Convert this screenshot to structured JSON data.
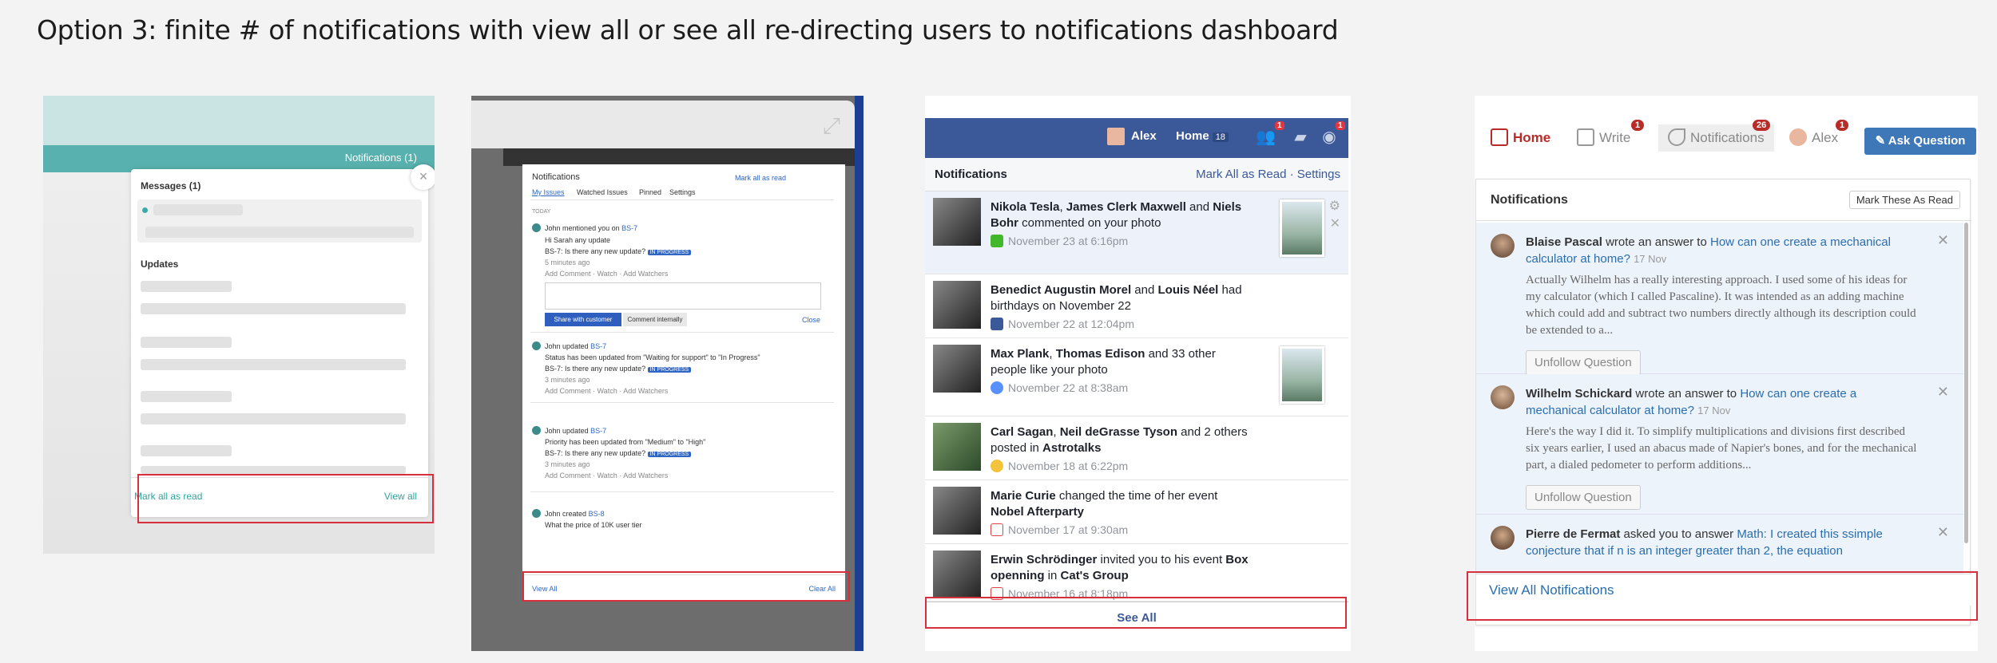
{
  "heading": "Option 3: finite # of notifications with view all or see all re-directing users to notifications dashboard",
  "panel1": {
    "notifications_label": "Notifications (1)",
    "close_glyph": "×",
    "messages_header": "Messages (1)",
    "updates_header": "Updates",
    "mark_all_read": "Mark all as read",
    "view_all": "View all"
  },
  "panel2": {
    "title": "Notifications",
    "mark_all_read": "Mark all as read",
    "tabs": [
      "My Issues",
      "Watched Issues",
      "Pinned",
      "Settings"
    ],
    "section": "TODAY",
    "items": [
      {
        "actor": "John",
        "action": "mentioned you on",
        "key": "BS-7",
        "line": "Hi Sarah any update",
        "issue": "BS-7: Is there any new update?",
        "status": "IN PROGRESS",
        "time": "5 minutes ago",
        "actions": "Add Comment · Watch · Add Watchers"
      },
      {
        "actor": "John",
        "action": "updated",
        "key": "BS-7",
        "line": "Status has been updated from \"Waiting for support\" to \"In Progress\"",
        "issue": "BS-7: Is there any new update?",
        "status": "IN PROGRESS",
        "time": "3 minutes ago",
        "actions": "Add Comment · Watch · Add Watchers"
      },
      {
        "actor": "John",
        "action": "updated",
        "key": "BS-7",
        "line": "Priority has been updated from \"Medium\" to \"High\"",
        "issue": "BS-7: Is there any new update?",
        "status": "IN PROGRESS",
        "time": "3 minutes ago",
        "actions": "Add Comment · Watch · Add Watchers"
      },
      {
        "actor": "John",
        "action": "created",
        "key": "BS-8",
        "line": "What the price of 10K user tier"
      }
    ],
    "share_button": "Share with customer",
    "comment_button": "Comment internally",
    "close": "Close",
    "view_all": "View All",
    "clear_all": "Clear All"
  },
  "panel3": {
    "nav_name": "Alex",
    "nav_home": "Home",
    "nav_home_count": "18",
    "badge_friends": "1",
    "badge_messages": "1",
    "badge_globe": "1",
    "header": "Notifications",
    "header_links": "Mark All as Read · Settings",
    "rows": [
      {
        "bold1": "Nikola Tesla",
        "mid1": ", ",
        "bold2": "James Clerk Maxwell",
        "mid2": " and ",
        "bold3": "Niels Bohr",
        "rest": " commented on your photo",
        "time": "November 23 at 6:16pm"
      },
      {
        "bold1": "Benedict Augustin Morel",
        "mid1": " and ",
        "bold2": "Louis Néel",
        "mid2": "",
        "bold3": "",
        "rest": " had birthdays on November 22",
        "time": "November 22 at 12:04pm"
      },
      {
        "bold1": "Max Plank",
        "mid1": ", ",
        "bold2": "Thomas Edison",
        "mid2": "",
        "bold3": "",
        "rest": " and 33 other people like your photo",
        "time": "November 22 at 8:38am"
      },
      {
        "bold1": "Carl Sagan",
        "mid1": ", ",
        "bold2": "Neil deGrasse Tyson",
        "mid2": " and 2 others posted in ",
        "bold3": "Astrotalks",
        "rest": "",
        "time": "November 18 at 6:22pm"
      },
      {
        "bold1": "Marie Curie",
        "mid1": " changed the time of her event ",
        "bold2": "Nobel Afterparty",
        "mid2": "",
        "bold3": "",
        "rest": "",
        "time": "November 17 at 9:30am"
      },
      {
        "bold1": "Erwin Schrödinger",
        "mid1": " invited you to his event ",
        "bold2": "Box openning",
        "mid2": " in ",
        "bold3": "Cat's Group",
        "rest": "",
        "time": "November 16 at 8:18pm"
      }
    ],
    "see_all": "See All"
  },
  "panel4": {
    "nav_home": "Home",
    "nav_write": "Write",
    "nav_notifications": "Notifications",
    "nav_user": "Alex",
    "badge_write": "1",
    "badge_notifications": "26",
    "badge_user": "1",
    "ask_question": "Ask Question",
    "header": "Notifications",
    "mark_read": "Mark These As Read",
    "items": [
      {
        "name": "Blaise Pascal",
        "action": " wrote an answer to ",
        "link": "How can one create a mechanical calculator at home?",
        "date": "17 Nov",
        "body": "Actually Wilhelm has a really interesting approach. I used some of his ideas for my calculator (which I called Pascaline). It was intended as an adding machine which could add and subtract two numbers directly although its description could be extended to a...",
        "button": "Unfollow Question"
      },
      {
        "name": "Wilhelm Schickard",
        "action": " wrote an answer to ",
        "link": "How can one create a mechanical calculator at home?",
        "date": "17 Nov",
        "body": "Here's the way I did it. To simplify multiplications and divisions first described six years earlier, I used an abacus made of Napier's bones, and for the mechanical part, a dialed pedometer to perform additions...",
        "button": "Unfollow Question"
      },
      {
        "name": "Pierre de Fermat",
        "action": " asked you to answer ",
        "link": "Math: I created this ssimple conjecture that if n is an integer greater than 2, the equation",
        "date": "",
        "body": "",
        "button": ""
      }
    ],
    "view_all": "View All Notifications"
  }
}
